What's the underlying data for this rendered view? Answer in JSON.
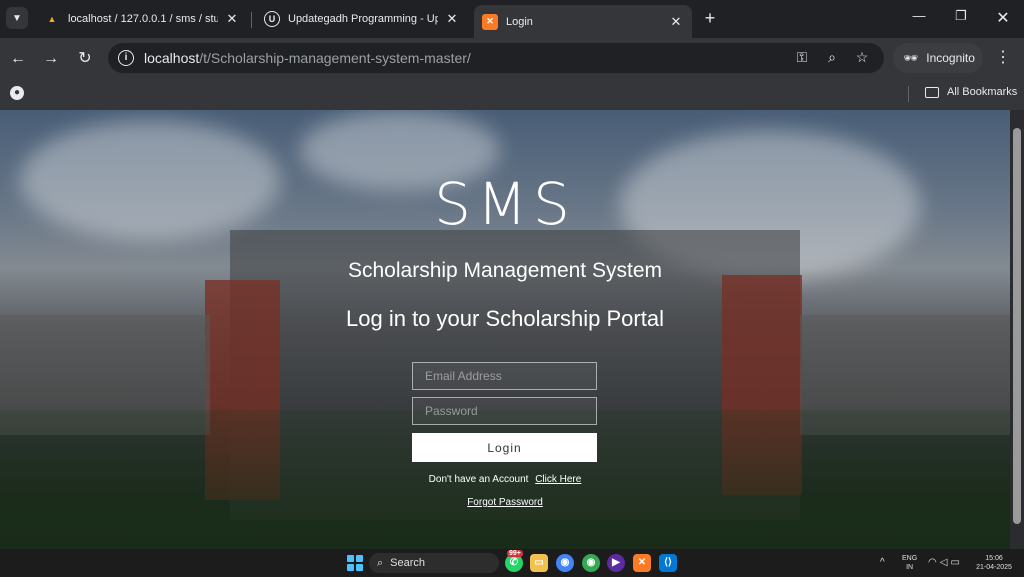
{
  "browser": {
    "tabs": [
      {
        "title": "localhost / 127.0.0.1 / sms / studer",
        "favicon": "phpmyadmin-icon",
        "active": false
      },
      {
        "title": "Updategadh Programming - Upda",
        "favicon": "updategadh-icon",
        "active": false
      },
      {
        "title": "Login",
        "favicon": "xampp-icon",
        "active": true
      }
    ],
    "url_host": "localhost",
    "url_path": "/t/Scholarship-management-system-master/",
    "incognito_label": "Incognito",
    "bookmarks_label": "All Bookmarks"
  },
  "page": {
    "logo": "SMS",
    "subtitle": "Scholarship Management System",
    "heading": "Log in to your Scholarship Portal",
    "email_placeholder": "Email Address",
    "password_placeholder": "Password",
    "login_label": "Login",
    "no_account_text": "Don't have an Account",
    "signup_link": "Click Here",
    "forgot_link": "Forgot Password"
  },
  "taskbar": {
    "search_label": "Search",
    "whatsapp_badge": "99+",
    "language": "ENG",
    "region": "IN",
    "time": "15:06",
    "date": "21-04-2025"
  },
  "colors": {
    "accent": "#4cc2ff",
    "browser_dark": "#202124",
    "browser_toolbar": "#35363a"
  }
}
